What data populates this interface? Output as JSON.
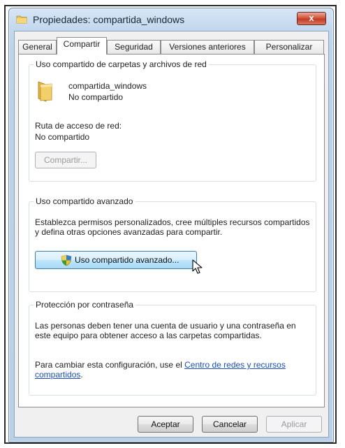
{
  "window": {
    "title": "Propiedades: compartida_windows",
    "close_label": "x"
  },
  "tabs": [
    "General",
    "Compartir",
    "Seguridad",
    "Versiones anteriores",
    "Personalizar"
  ],
  "active_tab": "Compartir",
  "network_sharing": {
    "title": "Uso compartido de carpetas y archivos de red",
    "folder_name": "compartida_windows",
    "folder_status": "No compartido",
    "path_label": "Ruta de acceso de red:",
    "path_value": "No compartido",
    "share_button": "Compartir..."
  },
  "advanced_sharing": {
    "title": "Uso compartido avanzado",
    "description": "Establezca permisos personalizados, cree múltiples recursos compartidos y defina otras opciones avanzadas para compartir.",
    "button": "Uso compartido avanzado..."
  },
  "password_protection": {
    "title": "Protección por contraseña",
    "description": "Las personas deben tener una cuenta de usuario y una contraseña en este equipo para obtener acceso a las carpetas compartidas.",
    "change_text": "Para cambiar esta configuración, use el",
    "link": "Centro de redes y recursos compartidos",
    "link_suffix": "."
  },
  "footer": {
    "ok": "Aceptar",
    "cancel": "Cancelar",
    "apply": "Aplicar"
  },
  "colors": {
    "accent": "#3c7fb1",
    "link": "#1a4fc0",
    "close": "#c23d26"
  }
}
